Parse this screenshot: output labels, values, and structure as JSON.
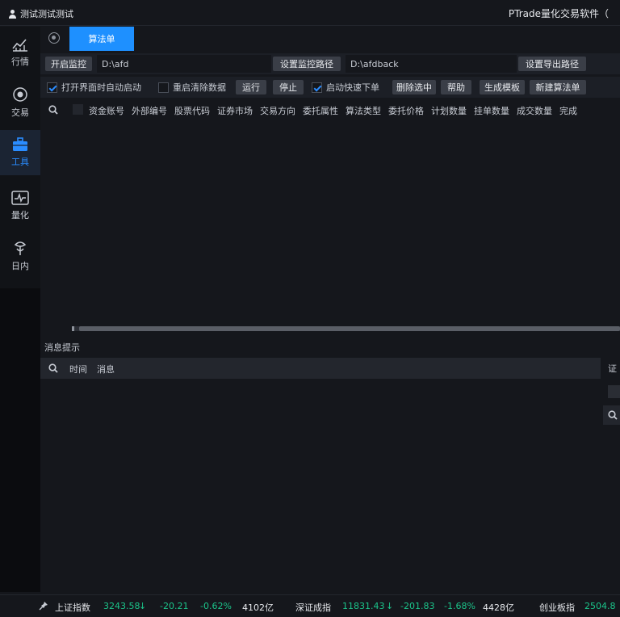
{
  "titlebar": {
    "user": "测试测试测试",
    "app_title": "PTrade量化交易软件（"
  },
  "sidebar": {
    "items": [
      {
        "label": "行情",
        "icon": "chart-icon"
      },
      {
        "label": "交易",
        "icon": "trade-icon"
      },
      {
        "label": "工具",
        "icon": "toolbox-icon",
        "active": true
      },
      {
        "label": "量化",
        "icon": "quant-icon"
      },
      {
        "label": "日内",
        "icon": "intraday-icon"
      }
    ]
  },
  "tabs": [
    {
      "label": "算法单",
      "active": true
    }
  ],
  "toolbar": {
    "start_monitor": "开启监控",
    "monitor_path": "D:\\afd",
    "set_monitor_path": "设置监控路径",
    "export_path": "D:\\afdback",
    "set_export_path": "设置导出路径",
    "auto_start_label": "打开界面时自动启动",
    "auto_start_checked": true,
    "restart_clear_label": "重启清除数据",
    "restart_clear_checked": false,
    "run": "运行",
    "stop": "停止",
    "quick_order_label": "启动快速下单",
    "quick_order_checked": true,
    "delete_selected": "删除选中",
    "help": "帮助",
    "generate_template": "生成模板",
    "new_algo_order": "新建算法单"
  },
  "table": {
    "columns": [
      "资金账号",
      "外部编号",
      "股票代码",
      "证券市场",
      "交易方向",
      "委托属性",
      "算法类型",
      "委托价格",
      "计划数量",
      "挂单数量",
      "成交数量",
      "完成"
    ]
  },
  "messages": {
    "title": "消息提示",
    "columns": [
      "时间",
      "消息"
    ],
    "right_label": "证"
  },
  "status": {
    "indices": [
      {
        "name": "上证指数",
        "price": "3243.58",
        "change": "-20.21",
        "pct": "-0.62%",
        "volume": "4102亿"
      },
      {
        "name": "深证成指",
        "price": "11831.43",
        "change": "-201.83",
        "pct": "-1.68%",
        "volume": "4428亿"
      },
      {
        "name": "创业板指",
        "price": "2504.8"
      }
    ]
  },
  "colors": {
    "accent": "#1e90ff",
    "down": "#1bc48a",
    "background": "#15171c"
  }
}
